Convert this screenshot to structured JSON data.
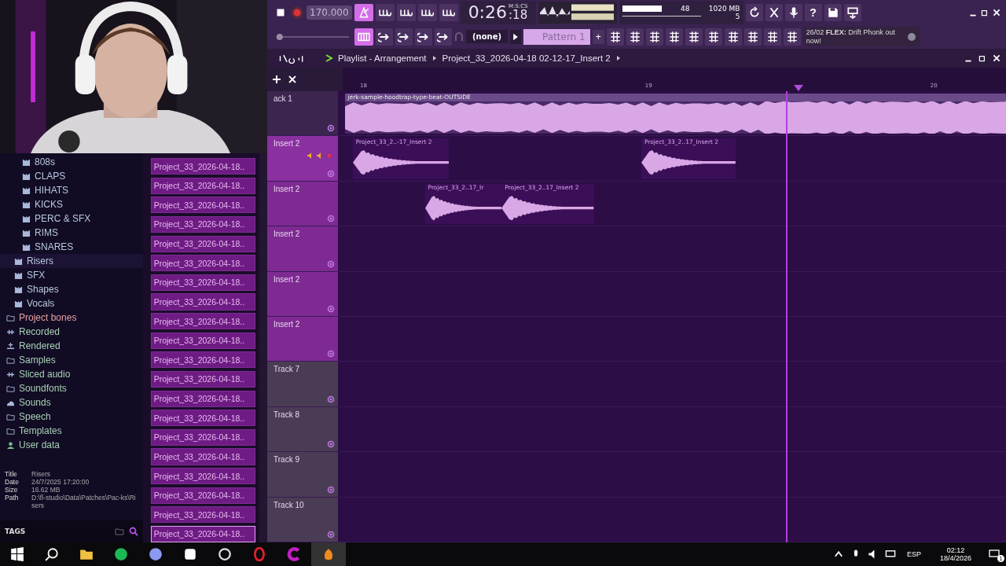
{
  "toolbar": {
    "tempo": "170.000",
    "mode_buttons": [
      {
        "on": true
      },
      {
        "on": false
      },
      {
        "on": false
      },
      {
        "on": false
      },
      {
        "on": false
      }
    ],
    "time": "0:26",
    "time_cs": ":18",
    "time_unit": "M:S:CS",
    "cpu": "48",
    "memory": "1020 MB",
    "polyphony": "5",
    "help": "?",
    "pattern_preset": "(none)",
    "pattern": "Pattern 1",
    "add": "+",
    "song_mode": {
      "on": true
    },
    "pitch": {
      "level": 0.02
    },
    "news": "26/02 **FLEX:** Drift Phonk out now!"
  },
  "browser": {
    "tree": [
      {
        "children": [
          {
            "children": [
              {
                "label": "808s",
                "selected": false,
                "kind": "pack"
              },
              {
                "label": "CLAPS",
                "selected": false,
                "kind": "pack"
              },
              {
                "label": "HIHATS",
                "selected": false,
                "kind": "pack"
              },
              {
                "label": "KICKS",
                "selected": false,
                "kind": "pack"
              },
              {
                "label": "PERC & SFX",
                "selected": false,
                "kind": "pack"
              },
              {
                "label": "RIMS",
                "selected": false,
                "kind": "pack"
              },
              {
                "label": "SNARES",
                "selected": false,
                "kind": "pack"
              }
            ]
          },
          {
            "label": "Risers",
            "selected": true,
            "kind": "pack"
          },
          {
            "label": "SFX",
            "selected": false,
            "kind": "pack"
          },
          {
            "label": "Shapes",
            "selected": false,
            "kind": "pack"
          },
          {
            "label": "Vocals",
            "selected": false,
            "kind": "pack"
          }
        ]
      },
      {
        "label": "Project bones",
        "selected": false,
        "kind": "project"
      },
      {
        "label": "Recorded",
        "selected": false,
        "kind": "audio"
      },
      {
        "label": "Rendered",
        "selected": false,
        "kind": "render"
      },
      {
        "label": "Samples",
        "selected": false,
        "kind": "folder"
      },
      {
        "label": "Sliced audio",
        "selected": false,
        "kind": "audio"
      },
      {
        "label": "Soundfonts",
        "selected": false,
        "kind": "plain"
      },
      {
        "label": "Sounds",
        "selected": false,
        "kind": "cloud"
      },
      {
        "label": "Speech",
        "selected": false,
        "kind": "folder"
      },
      {
        "label": "Templates",
        "selected": false,
        "kind": "folder"
      },
      {
        "label": "User data",
        "selected": false,
        "kind": "user"
      }
    ],
    "info": [
      {
        "label": "Title",
        "value": "Risers"
      },
      {
        "label": "Date",
        "value": "24/7/2025 17:20:00"
      },
      {
        "label": "Size",
        "value": "16.62 MB"
      },
      {
        "label": "Path",
        "value": "D:\\fl-studio\\Data\\Patches\\Pac-ks\\Risers"
      }
    ],
    "tags_label": "TAGS"
  },
  "file_list": [
    {
      "label": "Project_33_2026-04-18..",
      "selected": false
    },
    {
      "label": "Project_33_2026-04-18..",
      "selected": false
    },
    {
      "label": "Project_33_2026-04-18..",
      "selected": false
    },
    {
      "label": "Project_33_2026-04-18..",
      "selected": false
    },
    {
      "label": "Project_33_2026-04-18..",
      "selected": false
    },
    {
      "label": "Project_33_2026-04-18..",
      "selected": false
    },
    {
      "label": "Project_33_2026-04-18..",
      "selected": false
    },
    {
      "label": "Project_33_2026-04-18..",
      "selected": false
    },
    {
      "label": "Project_33_2026-04-18..",
      "selected": false
    },
    {
      "label": "Project_33_2026-04-18..",
      "selected": false
    },
    {
      "label": "Project_33_2026-04-18..",
      "selected": false
    },
    {
      "label": "Project_33_2026-04-18..",
      "selected": false
    },
    {
      "label": "Project_33_2026-04-18..",
      "selected": false
    },
    {
      "label": "Project_33_2026-04-18..",
      "selected": false
    },
    {
      "label": "Project_33_2026-04-18..",
      "selected": false
    },
    {
      "label": "Project_33_2026-04-18..",
      "selected": false
    },
    {
      "label": "Project_33_2026-04-18..",
      "selected": false
    },
    {
      "label": "Project_33_2026-04-18..",
      "selected": false
    },
    {
      "label": "Project_33_2026-04-18..",
      "selected": false
    },
    {
      "label": "Project_33_2026-04-18..",
      "selected": true
    }
  ],
  "playlist": {
    "title": "Playlist - Arrangement",
    "breadcrumb": "Project_33_2026-04-18 02-12-17_Insert 2",
    "ruler": [
      "18",
      "19",
      "20"
    ],
    "tracks": [
      {
        "name": "ack 1",
        "color": "#3c2650",
        "selected": false,
        "clips": [
          {
            "label": "jerk-sample-hoodtrap-type-beat-OUTSIDE",
            "kind": "loop"
          }
        ]
      },
      {
        "name": "Insert 2",
        "color": "#8a30a0",
        "selected": true,
        "clips": [
          {
            "label": "Project_33_2..-17_Insert 2",
            "kind": "hit"
          },
          {
            "label": "Project_33_2..17_Insert 2",
            "kind": "hit"
          }
        ]
      },
      {
        "name": "Insert 2",
        "color": "#7e2a92",
        "selected": false,
        "clips": [
          {
            "label": "Project_33_2..17_Ir",
            "kind": "hit"
          },
          {
            "label": "Project_33_2..17_Insert 2",
            "kind": "hit"
          }
        ]
      },
      {
        "name": "Insert 2",
        "color": "#7e2a92",
        "selected": false
      },
      {
        "name": "Insert 2",
        "color": "#7e2a92",
        "selected": false
      },
      {
        "name": "Insert 2",
        "color": "#7e2a92",
        "selected": false
      },
      {
        "name": "Track 7",
        "color": "#4a3c55",
        "selected": false
      },
      {
        "name": "Track 8",
        "color": "#4a3c55",
        "selected": false
      },
      {
        "name": "Track 9",
        "color": "#4a3c55",
        "selected": false
      },
      {
        "name": "Track 10",
        "color": "#4a3c55",
        "selected": false
      }
    ]
  },
  "taskbar": {
    "language": "ESP",
    "time": "02:12",
    "date": "18/4/2026",
    "notifications": "1"
  }
}
